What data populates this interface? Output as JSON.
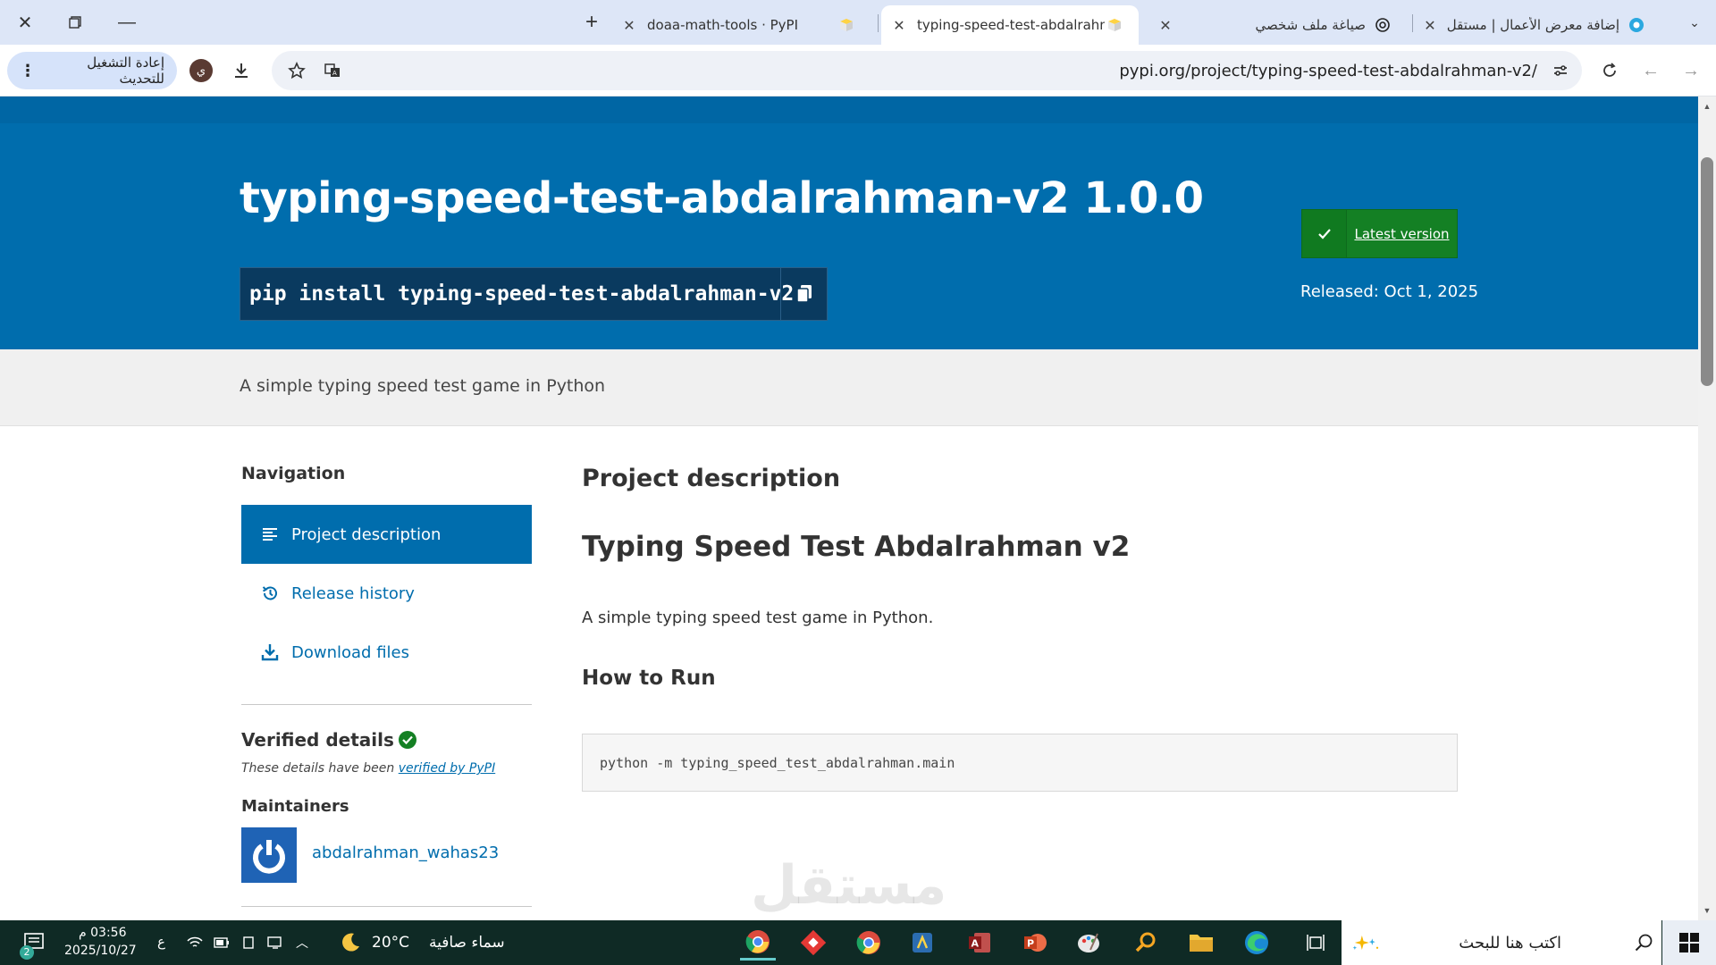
{
  "browser": {
    "tabs": [
      {
        "title": "إضافة معرض الأعمال | مستقل",
        "active": false
      },
      {
        "title": "صياغة ملف شخصي",
        "active": false
      },
      {
        "title": "typing-speed-test-abdalrahman",
        "active": true
      },
      {
        "title": "doaa-math-tools · PyPI",
        "active": false
      }
    ],
    "url": "pypi.org/project/typing-speed-test-abdalrahman-v2/",
    "update_button": "إعادة التشغيل للتحديث",
    "profile_initial": "ي"
  },
  "header": {
    "title": "typing-speed-test-abdalrahman-v2 1.0.0",
    "pip_command": "pip install typing-speed-test-abdalrahman-v2",
    "latest_version_label": "Latest version",
    "released": "Released: Oct 1, 2025"
  },
  "summary": "A simple typing speed test game in Python",
  "sidebar": {
    "heading": "Navigation",
    "items": [
      {
        "label": "Project description",
        "icon": "align-left-icon",
        "active": true
      },
      {
        "label": "Release history",
        "icon": "history-icon",
        "active": false
      },
      {
        "label": "Download files",
        "icon": "download-icon",
        "active": false
      }
    ],
    "verified_heading": "Verified details",
    "verified_note_prefix": "These details have been ",
    "verified_note_link": "verified by PyPI",
    "maintainers_heading": "Maintainers",
    "maintainer": "abdalrahman_wahas23"
  },
  "main": {
    "heading": "Project description",
    "readme_title": "Typing Speed Test Abdalrahman v2",
    "readme_intro": "A simple typing speed test game in Python.",
    "how_to_run": "How to Run",
    "code": "python -m typing_speed_test_abdalrahman.main"
  },
  "watermark": "مستقل",
  "taskbar": {
    "search_placeholder": "اكتب هنا للبحث",
    "weather_text": "سماء صافية",
    "temperature": "20°C",
    "time": "03:56 م",
    "date": "2025/10/27",
    "lang": "ع",
    "notification_count": "2"
  },
  "colors": {
    "pypi_blue": "#006dad",
    "badge_green": "#148024",
    "taskbar_bg": "#0f2a25"
  }
}
